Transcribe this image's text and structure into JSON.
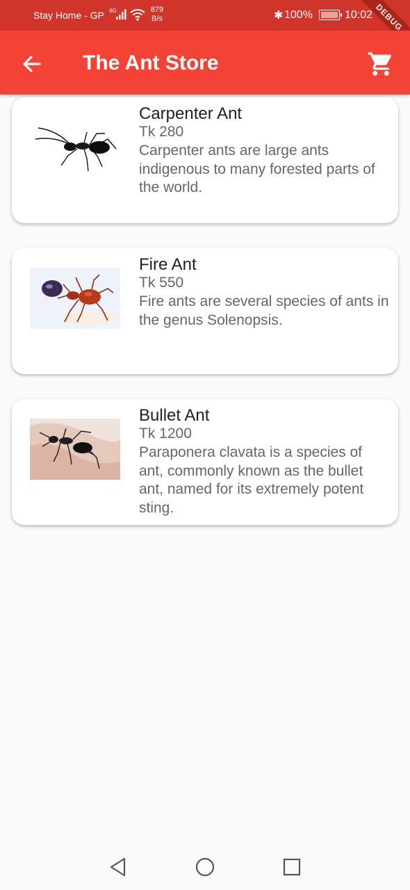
{
  "status_bar": {
    "carrier": "Stay Home - GP",
    "network": "4G",
    "speed_value": "879",
    "speed_unit": "B/s",
    "battery": "100%",
    "time": "10:02"
  },
  "debug_banner": "DEBUG",
  "app_bar": {
    "title": "The Ant Store",
    "back_icon": "arrow-back-icon",
    "cart_icon": "shopping-cart-icon"
  },
  "products": [
    {
      "name": "Carpenter Ant",
      "price": "Tk 280",
      "description": "Carpenter ants are large ants indigenous to many forested parts of the world."
    },
    {
      "name": "Fire Ant",
      "price": "Tk 550",
      "description": "Fire ants are several species of ants in the genus Solenopsis."
    },
    {
      "name": "Bullet Ant",
      "price": "Tk 1200",
      "description": "Paraponera clavata is a species of ant, commonly known as the bullet ant, named for its extremely potent sting."
    }
  ],
  "colors": {
    "app_bar": "#f44336",
    "status_bar": "#d0352c",
    "background": "#fafafa"
  }
}
